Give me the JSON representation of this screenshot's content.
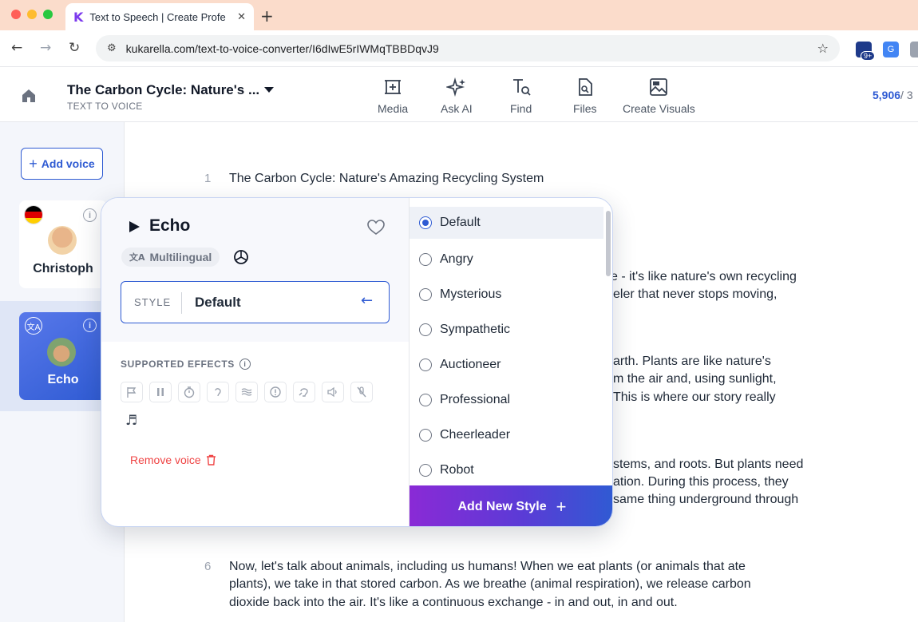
{
  "browser": {
    "tab_title": "Text to Speech | Create Profe",
    "tab_logo": "K",
    "url": "kukarella.com/text-to-voice-converter/I6dIwE5rIWMqTBBDqvJ9",
    "extension_badge": "9+"
  },
  "header": {
    "doc_title": "The Carbon Cycle: Nature's ...",
    "doc_subtitle": "TEXT TO VOICE",
    "tools": [
      {
        "label": "Media",
        "icon": "media-icon"
      },
      {
        "label": "Ask AI",
        "icon": "sparkle-icon"
      },
      {
        "label": "Find",
        "icon": "find-icon"
      },
      {
        "label": "Files",
        "icon": "files-icon"
      },
      {
        "label": "Create Visuals",
        "icon": "image-icon"
      }
    ],
    "char_count": "5,906",
    "char_count_rest": "/ 3"
  },
  "sidebar": {
    "add_voice_label": "Add voice",
    "voices": [
      {
        "name": "Christoph",
        "flag": "de-flag-icon",
        "active": false
      },
      {
        "name": "Echo",
        "flag": "multilingual-icon",
        "active": true
      }
    ]
  },
  "editor": {
    "lines": [
      {
        "num": "1",
        "text": "The Carbon Cycle: Nature's Amazing Recycling System"
      },
      {
        "text": "e - it's like nature's own recycling"
      },
      {
        "text": "eler that never stops moving,"
      },
      {
        "text": "arth. Plants are like nature's"
      },
      {
        "text": "m the air and, using sunlight,"
      },
      {
        "text": "This is where our story really"
      },
      {
        "text": "stems, and roots. But plants need"
      },
      {
        "text": "ation. During this process, they"
      },
      {
        "text": "same thing underground through"
      },
      {
        "num": "6",
        "text": "Now, let's talk about animals, including us humans! When we eat plants (or animals that ate"
      },
      {
        "text": "plants), we take in that stored carbon. As we breathe (animal respiration), we release carbon"
      },
      {
        "text": "dioxide back into the air. It's like a continuous exchange - in and out, in and out."
      }
    ]
  },
  "popup": {
    "voice_name": "Echo",
    "tag": "Multilingual",
    "style_label": "STYLE",
    "style_value": "Default",
    "effects_label": "SUPPORTED EFFECTS",
    "effects": [
      "flag-icon",
      "pause-icon",
      "timer-icon",
      "ear-icon",
      "waves-icon",
      "alert-icon",
      "hearing-icon",
      "volume-icon",
      "mute-icon"
    ],
    "remove_label": "Remove voice",
    "styles": [
      "Default",
      "Angry",
      "Mysterious",
      "Sympathetic",
      "Auctioneer",
      "Professional",
      "Cheerleader",
      "Robot"
    ],
    "selected_style": "Default",
    "add_style_label": "Add New Style"
  },
  "colors": {
    "accent": "#2f5bd3",
    "danger": "#ef4444",
    "tab_bar": "#fbdccb"
  }
}
